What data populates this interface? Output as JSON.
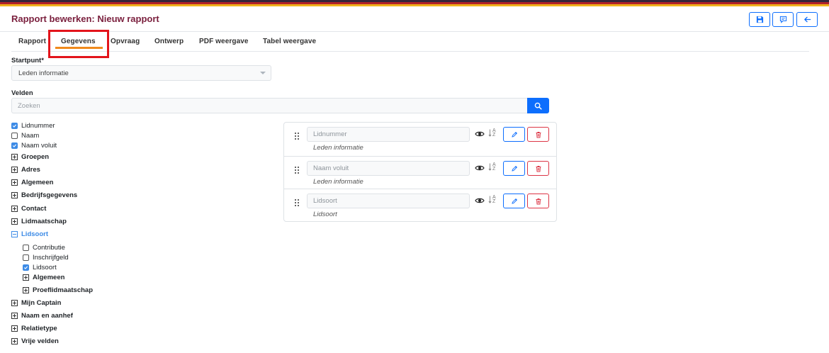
{
  "colors": {
    "accent": "#0d6efd",
    "danger": "#dc3545",
    "title": "#7a1f3d",
    "tab_underline": "#f08a1c",
    "highlight_box": "#e3141b",
    "tree_expanded": "#3d8be6"
  },
  "header": {
    "title": "Rapport bewerken: Nieuw rapport",
    "buttons": [
      {
        "name": "save-button",
        "icon": "floppy-disk-icon"
      },
      {
        "name": "comment-button",
        "icon": "comment-icon"
      },
      {
        "name": "back-button",
        "icon": "arrow-left-icon"
      }
    ]
  },
  "tabs": [
    {
      "label": "Rapport",
      "active": false
    },
    {
      "label": "Gegevens",
      "active": true
    },
    {
      "label": "Opvraag",
      "active": false
    },
    {
      "label": "Ontwerp",
      "active": false
    },
    {
      "label": "PDF weergave",
      "active": false
    },
    {
      "label": "Tabel weergave",
      "active": false
    }
  ],
  "form": {
    "startpunt_label": "Startpunt*",
    "startpunt_value": "Leden informatie",
    "velden_label": "Velden",
    "search_placeholder": "Zoeken"
  },
  "tree": [
    {
      "label": "Lidnummer",
      "type": "checkbox",
      "checked": true
    },
    {
      "label": "Naam",
      "type": "checkbox",
      "checked": false
    },
    {
      "label": "Naam voluit",
      "type": "checkbox",
      "checked": true
    },
    {
      "label": "Groepen",
      "type": "group",
      "expanded": false
    },
    {
      "label": "Adres",
      "type": "group",
      "expanded": false
    },
    {
      "label": "Algemeen",
      "type": "group",
      "expanded": false
    },
    {
      "label": "Bedrijfsgegevens",
      "type": "group",
      "expanded": false
    },
    {
      "label": "Contact",
      "type": "group",
      "expanded": false
    },
    {
      "label": "Lidmaatschap",
      "type": "group",
      "expanded": false
    },
    {
      "label": "Lidsoort",
      "type": "group",
      "expanded": true
    },
    {
      "label": "Contributie",
      "type": "checkbox",
      "checked": false
    },
    {
      "label": "Inschrijfgeld",
      "type": "checkbox",
      "checked": false
    },
    {
      "label": "Lidsoort",
      "type": "checkbox",
      "checked": true
    },
    {
      "label": "Algemeen",
      "type": "group",
      "expanded": false
    },
    {
      "label": "Proeflidmaatschap",
      "type": "group",
      "expanded": false
    },
    {
      "label": "Mijn Captain",
      "type": "group",
      "expanded": false
    },
    {
      "label": "Naam en aanhef",
      "type": "group",
      "expanded": false
    },
    {
      "label": "Relatietype",
      "type": "group",
      "expanded": false
    },
    {
      "label": "Vrije velden",
      "type": "group",
      "expanded": false
    }
  ],
  "selected_fields": [
    {
      "placeholder": "Lidnummer",
      "source": "Leden informatie"
    },
    {
      "placeholder": "Naam voluit",
      "source": "Leden informatie"
    },
    {
      "placeholder": "Lidsoort",
      "source": "Lidsoort"
    }
  ],
  "sort_glyph": {
    "top": "A",
    "bottom": "Z"
  }
}
